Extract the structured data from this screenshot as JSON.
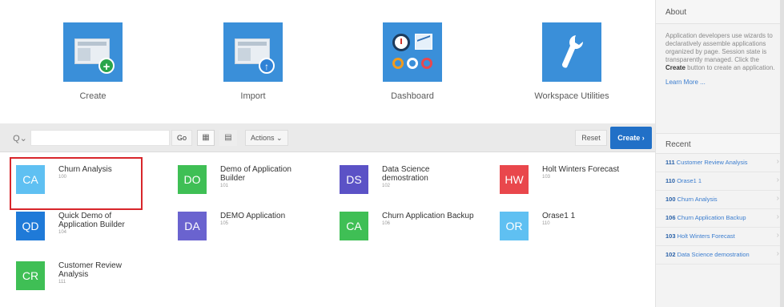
{
  "hero": {
    "items": [
      {
        "label": "Create",
        "color": "#3a8fd9"
      },
      {
        "label": "Import",
        "color": "#3a8fd9"
      },
      {
        "label": "Dashboard",
        "color": "#3a8fd9"
      },
      {
        "label": "Workspace Utilities",
        "color": "#3a8fd9"
      }
    ]
  },
  "toolbar": {
    "search_placeholder": "",
    "search_icon_glyph": "Q⌄",
    "go_label": "Go",
    "grid_glyph": "▦",
    "list_glyph": "▤",
    "actions_label": "Actions ⌄",
    "reset_label": "Reset",
    "create_label": "Create ›"
  },
  "apps": [
    {
      "initials": "CA",
      "name": "Churn Analysis",
      "id": "100",
      "color": "#5fc0f2",
      "selected": true
    },
    {
      "initials": "DO",
      "name": "Demo of Application Builder",
      "id": "101",
      "color": "#3fbf55",
      "selected": false
    },
    {
      "initials": "DS",
      "name": "Data Science demostration",
      "id": "102",
      "color": "#5b52c6",
      "selected": false
    },
    {
      "initials": "HW",
      "name": "Holt Winters Forecast",
      "id": "103",
      "color": "#e9474c",
      "selected": false
    },
    {
      "initials": "QD",
      "name": "Quick Demo of Application Builder",
      "id": "104",
      "color": "#1f7ad8",
      "selected": false
    },
    {
      "initials": "DA",
      "name": "DEMO Application",
      "id": "105",
      "color": "#6a63cf",
      "selected": false
    },
    {
      "initials": "CA",
      "name": "Churn Application Backup",
      "id": "106",
      "color": "#3fbf55",
      "selected": false
    },
    {
      "initials": "OR",
      "name": "Orase1 1",
      "id": "110",
      "color": "#5fc0f2",
      "selected": false
    },
    {
      "initials": "CR",
      "name": "Customer Review Analysis",
      "id": "111",
      "color": "#3fbf55",
      "selected": false
    }
  ],
  "about": {
    "title": "About",
    "text_before": "Application developers use wizards to declaratively assemble applications organized by page. Session state is transparently managed. Click the",
    "text_bold": "Create",
    "text_after": "button to create an application.",
    "learn_more": "Learn More ..."
  },
  "recent": {
    "title": "Recent",
    "items": [
      {
        "id": "111",
        "name": "Customer Review Analysis"
      },
      {
        "id": "110",
        "name": "Orase1 1"
      },
      {
        "id": "100",
        "name": "Churn Analysis"
      },
      {
        "id": "106",
        "name": "Churn Application Backup"
      },
      {
        "id": "103",
        "name": "Holt Winters Forecast"
      },
      {
        "id": "102",
        "name": "Data Science demostration"
      }
    ]
  }
}
